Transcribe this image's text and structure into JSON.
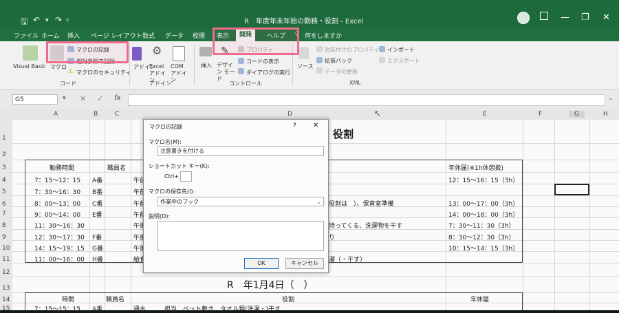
{
  "window": {
    "title": "R　年度年末年始の勤務・役割 - Excel",
    "qat_icons": [
      "save-icon",
      "undo-icon",
      "redo-icon",
      "customize-qat-icon"
    ],
    "minimize": "—",
    "restore": "❐",
    "close": "✕"
  },
  "tabs": [
    "ファイル",
    "ホーム",
    "挿入",
    "ページ レイアウト",
    "数式",
    "データ",
    "校閲",
    "表示",
    "開発",
    "ヘルプ"
  ],
  "active_tab": "開発",
  "tell_me": "何をしますか",
  "ribbon": {
    "code_group": {
      "label": "コード",
      "visual_basic": "Visual Basic",
      "macro": "マクロ",
      "record_macro": "マクロの記録",
      "relative_ref": "相対参照で記録",
      "macro_security": "マクロのセキュリティ"
    },
    "addin_group": {
      "label": "アドイン",
      "addin": "アドイン",
      "excel_addin": "Excel アドイン",
      "com_addin": "COM アドイン"
    },
    "control_group": {
      "label": "コントロール",
      "insert": "挿入",
      "design_mode": "デザイン モード",
      "properties": "プロパティ",
      "view_code": "コードの表示",
      "run_dialog": "ダイアログの実行"
    },
    "xml_group": {
      "label": "XML",
      "source": "ソース",
      "map_properties": "対応付けのプロパティ",
      "expansion_packs": "拡張パック",
      "refresh_data": "データの更新",
      "import": "インポート",
      "export": "エクスポート"
    }
  },
  "formula_bar": {
    "name_box": "G5",
    "fx": "fx",
    "formula": ""
  },
  "columns": [
    "A",
    "B",
    "C",
    "D",
    "E",
    "F",
    "G",
    "H"
  ],
  "rows": [
    "1",
    "2",
    "3",
    "4",
    "5",
    "6",
    "7",
    "8",
    "9",
    "10",
    "11",
    "12",
    "13",
    "14",
    "15"
  ],
  "sheet": {
    "title_tail": "役割",
    "header_time": "勤務時間",
    "header_staff": "職員名",
    "header_leave": "年休届(※1h休憩扱)",
    "rows": [
      {
        "time": "7：15〜12：15",
        "shift": "A番",
        "role": "午前",
        "leave": "12：15〜16：15（3h）"
      },
      {
        "time": "7：30〜16：30",
        "shift": "B番",
        "role": "午前",
        "leave": ""
      },
      {
        "time": "8：00〜13：00",
        "shift": "C番",
        "role": "午前",
        "role_tail": "役割は　）、保育室準備",
        "leave": "13：00〜17：00（3h）"
      },
      {
        "time": "9：00〜14：00",
        "shift": "E番",
        "role": "午前",
        "leave": "14：00〜18：00（3h）"
      },
      {
        "time": "11：30〜16：30",
        "shift": "",
        "role": "午後",
        "role_tail": "持ってくる、洗濯物を干す",
        "leave": "7：30〜11：30（3h）"
      },
      {
        "time": "12：30〜17：30",
        "shift": "F番",
        "role": "午後",
        "role_tail": "り",
        "leave": "8：30〜12：30（3h）"
      },
      {
        "time": "14：15〜19：15",
        "shift": "G番",
        "role": "午後",
        "leave": "10：15〜14：15（3h）"
      },
      {
        "time": "11：00〜16：00",
        "shift": "H番",
        "role": "給食",
        "role_tail": "濯（・干す）",
        "leave": ""
      }
    ],
    "section2_title": "R　年1月4日（　）",
    "section2_time": "時間",
    "section2_staff": "職員名",
    "section2_role": "役割",
    "section2_leave": "年休届",
    "section2_row_time": "7：15〜15：15",
    "section2_row_shift": "A番",
    "section2_row_role": "通水　　　担当　ベット敷き　タオル類(洗濯・)干す"
  },
  "dialog": {
    "title": "マクロの記録",
    "help": "?",
    "close": "✕",
    "name_label": "マクロ名(M):",
    "name_value": "注意書きを付ける",
    "shortcut_label": "ショートカット キー(K):",
    "ctrl_label": "Ctrl+",
    "store_label": "マクロの保存先(I):",
    "store_value": "作業中のブック",
    "desc_label": "説明(D):",
    "ok": "OK",
    "cancel": "キャンセル"
  }
}
